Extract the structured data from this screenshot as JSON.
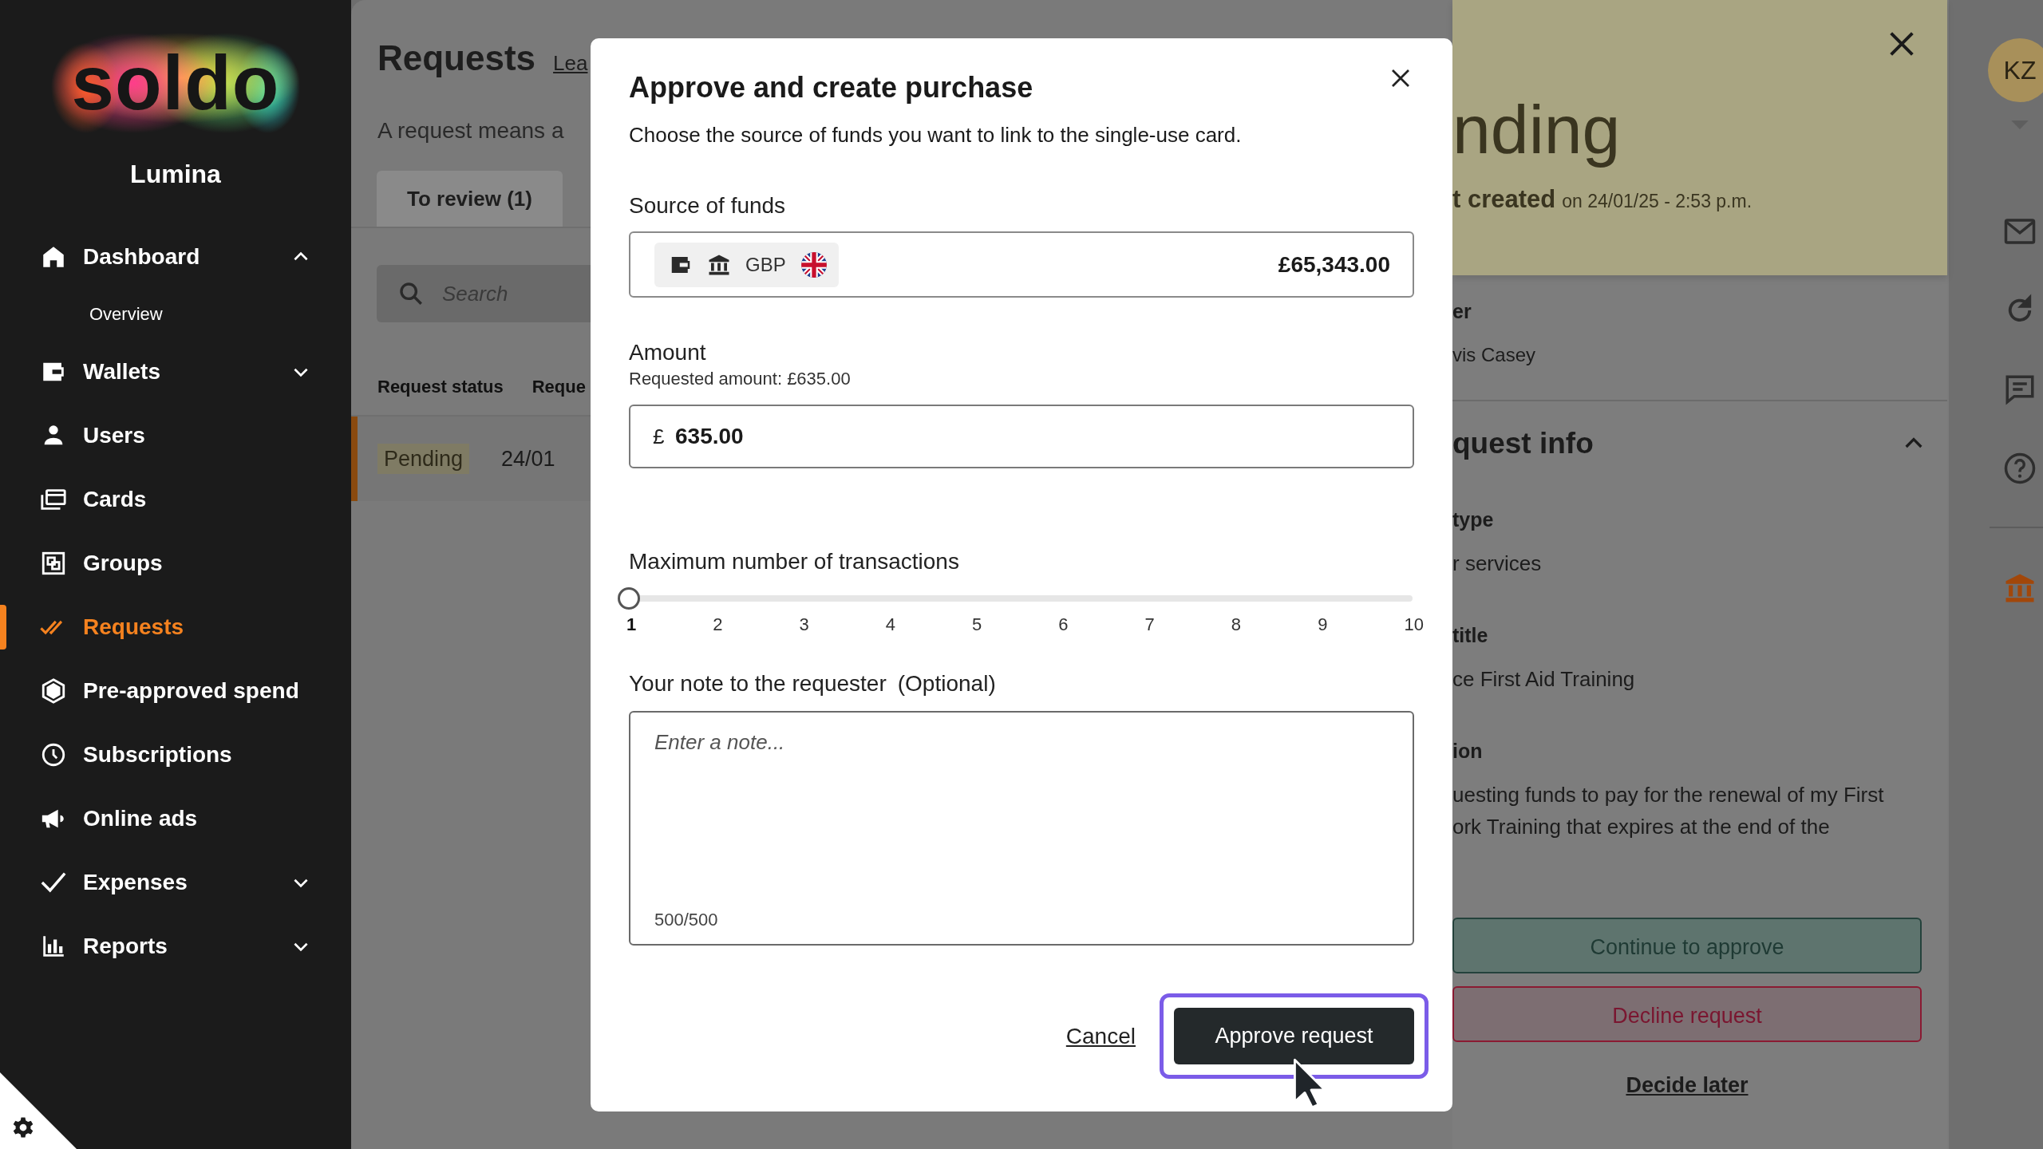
{
  "sidebar": {
    "logo": "soldo",
    "org": "Lumina",
    "items": [
      {
        "label": "Dashboard",
        "kind": "group",
        "expanded": true,
        "selected": false,
        "children": [
          {
            "label": "Overview",
            "selected": false
          }
        ]
      },
      {
        "label": "Wallets",
        "kind": "group",
        "expanded": false,
        "selected": false
      },
      {
        "label": "Users",
        "kind": "link",
        "selected": false
      },
      {
        "label": "Cards",
        "kind": "link",
        "selected": false
      },
      {
        "label": "Groups",
        "kind": "link",
        "selected": false
      },
      {
        "label": "Requests",
        "kind": "link",
        "selected": true
      },
      {
        "label": "Pre-approved spend",
        "kind": "link",
        "selected": false
      },
      {
        "label": "Subscriptions",
        "kind": "link",
        "selected": false
      },
      {
        "label": "Online ads",
        "kind": "link",
        "selected": false
      },
      {
        "label": "Expenses",
        "kind": "group",
        "expanded": false,
        "selected": false
      },
      {
        "label": "Reports",
        "kind": "group",
        "expanded": false,
        "selected": false
      }
    ]
  },
  "requests_page": {
    "title": "Requests",
    "link": "Lea",
    "description": "A request means a",
    "tabs": [
      {
        "label": "To review (1)",
        "selected": true
      }
    ],
    "search": {
      "placeholder": "Search"
    },
    "table": {
      "columns": [
        "Request status",
        "Reque"
      ],
      "rows": [
        {
          "status": "Pending",
          "date": "24/01",
          "selected": true
        }
      ]
    }
  },
  "modal": {
    "title": "Approve and create purchase",
    "subtitle": "Choose the source of funds you want to link to the single-use card.",
    "source": {
      "label": "Source of funds",
      "currency": "GBP",
      "balance": "£65,343.00"
    },
    "amount": {
      "label": "Amount",
      "hint": "Requested amount: £635.00",
      "symbol": "£",
      "value": "635.00"
    },
    "transactions": {
      "label": "Maximum number of transactions",
      "level": 0,
      "ticks": [
        "1",
        "2",
        "3",
        "4",
        "5",
        "6",
        "7",
        "8",
        "9",
        "10"
      ]
    },
    "note": {
      "label": "Your note to the requester",
      "optional": "(Optional)",
      "placeholder": "Enter a note...",
      "counter": "500/500"
    },
    "cancel": "Cancel",
    "approve": {
      "label": "Approve request",
      "focused": true
    }
  },
  "detail_panel": {
    "status": "nding",
    "created_label": "t created",
    "created_on": "on 24/01/25 - 2:53 p.m.",
    "requester": {
      "label": "er",
      "value": "vis Casey"
    },
    "section": {
      "title": "quest info",
      "expanded": true,
      "fields": [
        {
          "label": "type",
          "lines": [
            "r services"
          ]
        },
        {
          "label": "title",
          "lines": [
            "ce First Aid Training"
          ]
        },
        {
          "label": "ion",
          "lines": [
            "uesting funds to pay for the renewal of my First",
            "ork Training that expires at the end of the"
          ]
        }
      ]
    },
    "actions": [
      {
        "label": "Continue to approve",
        "kind": "approve"
      },
      {
        "label": "Decline request",
        "kind": "decline"
      },
      {
        "label": "Decide later",
        "kind": "link"
      }
    ]
  },
  "rail": {
    "avatar": "KZ",
    "buttons": [
      {
        "selected": false
      },
      {
        "selected": false
      },
      {
        "selected": false
      },
      {
        "selected": false
      },
      {
        "selected": true
      }
    ]
  }
}
